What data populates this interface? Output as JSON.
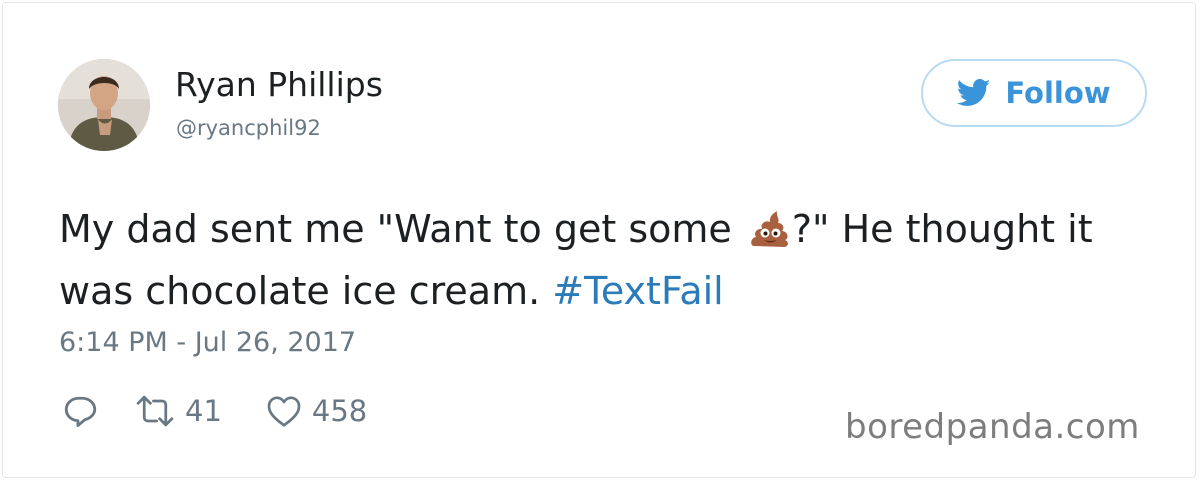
{
  "tweet": {
    "author": {
      "name": "Ryan Phillips",
      "handle": "@ryancphil92",
      "avatar_icon": "profile-photo"
    },
    "follow_button": {
      "label": "Follow",
      "icon": "twitter-bird-icon",
      "color": "#3b94d9"
    },
    "text": {
      "part1": "My dad sent me \"Want to get some ",
      "emoji": "pile-of-poo-emoji",
      "part2": "?\" He thought it was chocolate ice cream. ",
      "hashtag": "#TextFail"
    },
    "timestamp": "6:14 PM - Jul 26, 2017",
    "actions": {
      "reply_icon": "reply-icon",
      "retweet_icon": "retweet-icon",
      "retweet_count": "41",
      "like_icon": "heart-icon",
      "like_count": "458"
    }
  },
  "watermark": "boredpanda.com",
  "colors": {
    "link": "#2b7bb9",
    "secondary_text": "#697882",
    "primary_text": "#1c2022"
  }
}
